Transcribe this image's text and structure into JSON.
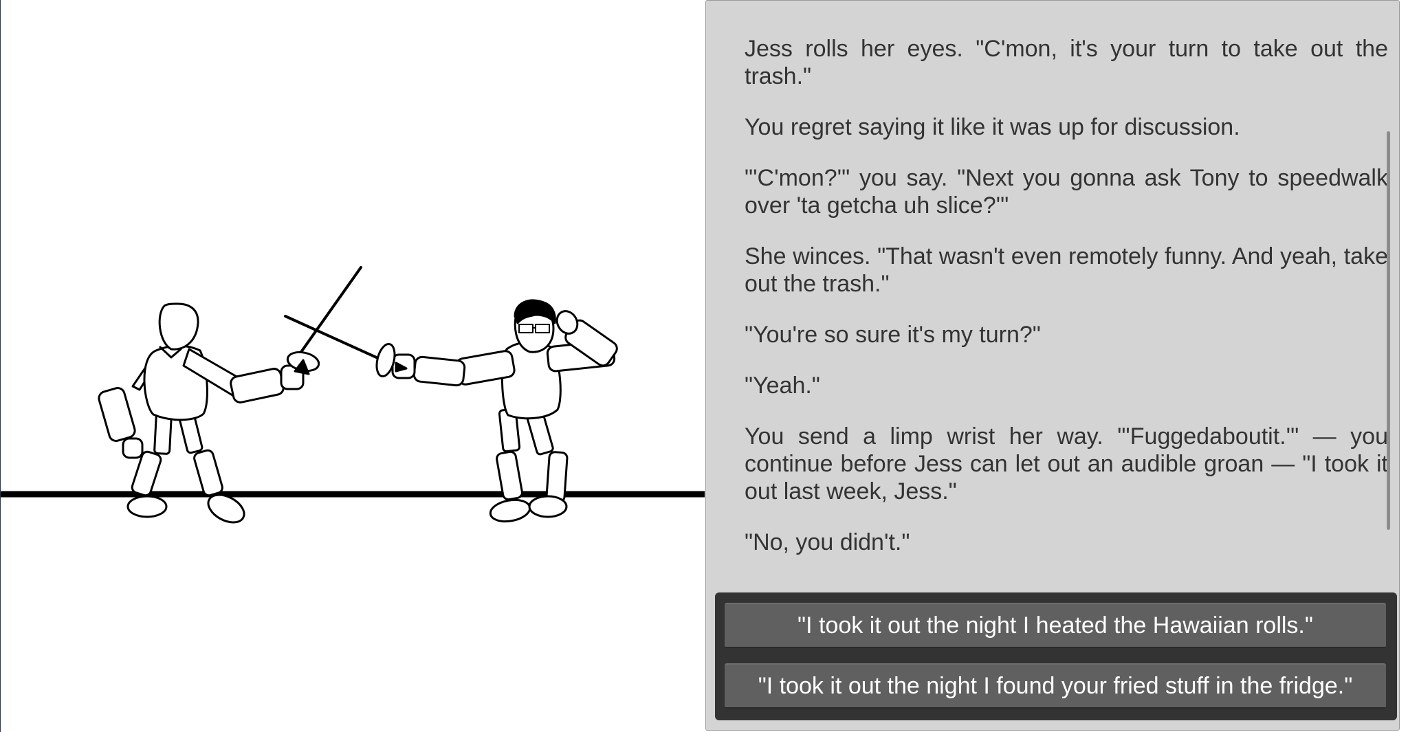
{
  "scene": {
    "illustration": "two-fencers-stick-figures"
  },
  "story": {
    "paragraphs": [
      "Jess rolls her eyes. \"C'mon, it's your turn to take out the trash.\"",
      "You regret saying it like it was up for discussion.",
      "\"'C'mon?'\" you say. \"Next you gonna ask Tony to speedwalk over 'ta getcha uh slice?'\"",
      "She winces. \"That wasn't even remotely funny. And yeah, take out the trash.\"",
      "\"You're so sure it's my turn?\"",
      "\"Yeah.\"",
      "You send a limp wrist her way. \"'Fuggedaboutit.'\" — you continue before Jess can let out an audible groan — \"I took it out last week, Jess.\"",
      "\"No, you didn't.\""
    ]
  },
  "choices": [
    "\"I took it out the night I heated the Hawaiian rolls.\"",
    "\"I took it out the night I found your fried stuff in the fridge.\""
  ],
  "colors": {
    "panel_bg": "#d4d4d4",
    "text": "#333333",
    "choice_box_bg": "#333333",
    "choice_button_bg": "#606060",
    "choice_text": "#ffffff"
  }
}
